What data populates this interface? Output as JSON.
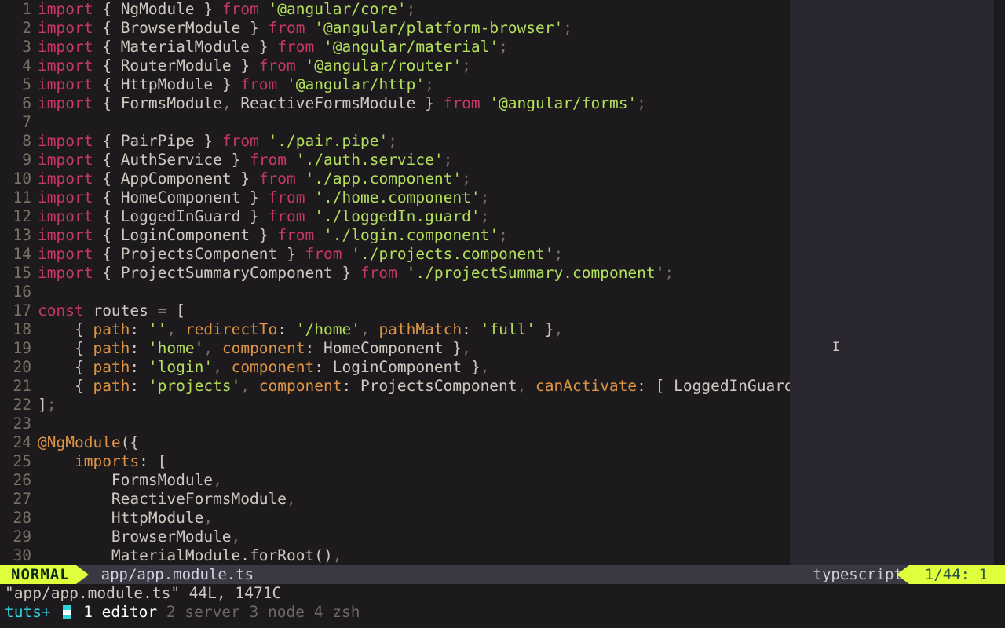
{
  "lines": [
    {
      "n": "1",
      "tokens": [
        {
          "c": "keyword",
          "t": "import"
        },
        {
          "c": "punct",
          "t": " { "
        },
        {
          "c": "ident",
          "t": "NgModule"
        },
        {
          "c": "punct",
          "t": " } "
        },
        {
          "c": "from",
          "t": "from"
        },
        {
          "c": "punct",
          "t": " "
        },
        {
          "c": "string",
          "t": "'@angular/core'"
        },
        {
          "c": "semi",
          "t": ";"
        }
      ]
    },
    {
      "n": "2",
      "tokens": [
        {
          "c": "keyword",
          "t": "import"
        },
        {
          "c": "punct",
          "t": " { "
        },
        {
          "c": "ident",
          "t": "BrowserModule"
        },
        {
          "c": "punct",
          "t": " } "
        },
        {
          "c": "from",
          "t": "from"
        },
        {
          "c": "punct",
          "t": " "
        },
        {
          "c": "string",
          "t": "'@angular/platform-browser'"
        },
        {
          "c": "semi",
          "t": ";"
        }
      ]
    },
    {
      "n": "3",
      "tokens": [
        {
          "c": "keyword",
          "t": "import"
        },
        {
          "c": "punct",
          "t": " { "
        },
        {
          "c": "ident",
          "t": "MaterialModule"
        },
        {
          "c": "punct",
          "t": " } "
        },
        {
          "c": "from",
          "t": "from"
        },
        {
          "c": "punct",
          "t": " "
        },
        {
          "c": "string",
          "t": "'@angular/material'"
        },
        {
          "c": "semi",
          "t": ";"
        }
      ]
    },
    {
      "n": "4",
      "tokens": [
        {
          "c": "keyword",
          "t": "import"
        },
        {
          "c": "punct",
          "t": " { "
        },
        {
          "c": "ident",
          "t": "RouterModule"
        },
        {
          "c": "punct",
          "t": " } "
        },
        {
          "c": "from",
          "t": "from"
        },
        {
          "c": "punct",
          "t": " "
        },
        {
          "c": "string",
          "t": "'@angular/router'"
        },
        {
          "c": "semi",
          "t": ";"
        }
      ]
    },
    {
      "n": "5",
      "tokens": [
        {
          "c": "keyword",
          "t": "import"
        },
        {
          "c": "punct",
          "t": " { "
        },
        {
          "c": "ident",
          "t": "HttpModule"
        },
        {
          "c": "punct",
          "t": " } "
        },
        {
          "c": "from",
          "t": "from"
        },
        {
          "c": "punct",
          "t": " "
        },
        {
          "c": "string",
          "t": "'@angular/http'"
        },
        {
          "c": "semi",
          "t": ";"
        }
      ]
    },
    {
      "n": "6",
      "tokens": [
        {
          "c": "keyword",
          "t": "import"
        },
        {
          "c": "punct",
          "t": " { "
        },
        {
          "c": "ident",
          "t": "FormsModule"
        },
        {
          "c": "comma",
          "t": ", "
        },
        {
          "c": "ident",
          "t": "ReactiveFormsModule"
        },
        {
          "c": "punct",
          "t": " } "
        },
        {
          "c": "from",
          "t": "from"
        },
        {
          "c": "punct",
          "t": " "
        },
        {
          "c": "string",
          "t": "'@angular/forms'"
        },
        {
          "c": "semi",
          "t": ";"
        }
      ]
    },
    {
      "n": "7",
      "tokens": []
    },
    {
      "n": "8",
      "tokens": [
        {
          "c": "keyword",
          "t": "import"
        },
        {
          "c": "punct",
          "t": " { "
        },
        {
          "c": "ident",
          "t": "PairPipe"
        },
        {
          "c": "punct",
          "t": " } "
        },
        {
          "c": "from",
          "t": "from"
        },
        {
          "c": "punct",
          "t": " "
        },
        {
          "c": "string",
          "t": "'./pair.pipe'"
        },
        {
          "c": "semi",
          "t": ";"
        }
      ]
    },
    {
      "n": "9",
      "tokens": [
        {
          "c": "keyword",
          "t": "import"
        },
        {
          "c": "punct",
          "t": " { "
        },
        {
          "c": "ident",
          "t": "AuthService"
        },
        {
          "c": "punct",
          "t": " } "
        },
        {
          "c": "from",
          "t": "from"
        },
        {
          "c": "punct",
          "t": " "
        },
        {
          "c": "string",
          "t": "'./auth.service'"
        },
        {
          "c": "semi",
          "t": ";"
        }
      ]
    },
    {
      "n": "10",
      "tokens": [
        {
          "c": "keyword",
          "t": "import"
        },
        {
          "c": "punct",
          "t": " { "
        },
        {
          "c": "ident",
          "t": "AppComponent"
        },
        {
          "c": "punct",
          "t": " } "
        },
        {
          "c": "from",
          "t": "from"
        },
        {
          "c": "punct",
          "t": " "
        },
        {
          "c": "string",
          "t": "'./app.component'"
        },
        {
          "c": "semi",
          "t": ";"
        }
      ]
    },
    {
      "n": "11",
      "tokens": [
        {
          "c": "keyword",
          "t": "import"
        },
        {
          "c": "punct",
          "t": " { "
        },
        {
          "c": "ident",
          "t": "HomeComponent"
        },
        {
          "c": "punct",
          "t": " } "
        },
        {
          "c": "from",
          "t": "from"
        },
        {
          "c": "punct",
          "t": " "
        },
        {
          "c": "string",
          "t": "'./home.component'"
        },
        {
          "c": "semi",
          "t": ";"
        }
      ]
    },
    {
      "n": "12",
      "tokens": [
        {
          "c": "keyword",
          "t": "import"
        },
        {
          "c": "punct",
          "t": " { "
        },
        {
          "c": "ident",
          "t": "LoggedInGuard"
        },
        {
          "c": "punct",
          "t": " } "
        },
        {
          "c": "from",
          "t": "from"
        },
        {
          "c": "punct",
          "t": " "
        },
        {
          "c": "string",
          "t": "'./loggedIn.guard'"
        },
        {
          "c": "semi",
          "t": ";"
        }
      ]
    },
    {
      "n": "13",
      "tokens": [
        {
          "c": "keyword",
          "t": "import"
        },
        {
          "c": "punct",
          "t": " { "
        },
        {
          "c": "ident",
          "t": "LoginComponent"
        },
        {
          "c": "punct",
          "t": " } "
        },
        {
          "c": "from",
          "t": "from"
        },
        {
          "c": "punct",
          "t": " "
        },
        {
          "c": "string",
          "t": "'./login.component'"
        },
        {
          "c": "semi",
          "t": ";"
        }
      ]
    },
    {
      "n": "14",
      "tokens": [
        {
          "c": "keyword",
          "t": "import"
        },
        {
          "c": "punct",
          "t": " { "
        },
        {
          "c": "ident",
          "t": "ProjectsComponent"
        },
        {
          "c": "punct",
          "t": " } "
        },
        {
          "c": "from",
          "t": "from"
        },
        {
          "c": "punct",
          "t": " "
        },
        {
          "c": "string",
          "t": "'./projects.component'"
        },
        {
          "c": "semi",
          "t": ";"
        }
      ]
    },
    {
      "n": "15",
      "tokens": [
        {
          "c": "keyword",
          "t": "import"
        },
        {
          "c": "punct",
          "t": " { "
        },
        {
          "c": "ident",
          "t": "ProjectSummaryComponent"
        },
        {
          "c": "punct",
          "t": " } "
        },
        {
          "c": "from",
          "t": "from"
        },
        {
          "c": "punct",
          "t": " "
        },
        {
          "c": "string",
          "t": "'./projectSummary.component'"
        },
        {
          "c": "semi",
          "t": ";"
        }
      ]
    },
    {
      "n": "16",
      "tokens": []
    },
    {
      "n": "17",
      "tokens": [
        {
          "c": "keyword",
          "t": "const"
        },
        {
          "c": "punct",
          "t": " "
        },
        {
          "c": "ident",
          "t": "routes = ["
        }
      ]
    },
    {
      "n": "18",
      "tokens": [
        {
          "c": "punct",
          "t": "    { "
        },
        {
          "c": "prop",
          "t": "path"
        },
        {
          "c": "punct",
          "t": ": "
        },
        {
          "c": "string",
          "t": "''"
        },
        {
          "c": "comma",
          "t": ", "
        },
        {
          "c": "prop",
          "t": "redirectTo"
        },
        {
          "c": "punct",
          "t": ": "
        },
        {
          "c": "string",
          "t": "'/home'"
        },
        {
          "c": "comma",
          "t": ", "
        },
        {
          "c": "prop",
          "t": "pathMatch"
        },
        {
          "c": "punct",
          "t": ": "
        },
        {
          "c": "string",
          "t": "'full'"
        },
        {
          "c": "punct",
          "t": " }"
        },
        {
          "c": "comma",
          "t": ","
        }
      ]
    },
    {
      "n": "19",
      "tokens": [
        {
          "c": "punct",
          "t": "    { "
        },
        {
          "c": "prop",
          "t": "path"
        },
        {
          "c": "punct",
          "t": ": "
        },
        {
          "c": "string",
          "t": "'home'"
        },
        {
          "c": "comma",
          "t": ", "
        },
        {
          "c": "prop",
          "t": "component"
        },
        {
          "c": "punct",
          "t": ": HomeComponent }"
        },
        {
          "c": "comma",
          "t": ","
        }
      ]
    },
    {
      "n": "20",
      "tokens": [
        {
          "c": "punct",
          "t": "    { "
        },
        {
          "c": "prop",
          "t": "path"
        },
        {
          "c": "punct",
          "t": ": "
        },
        {
          "c": "string",
          "t": "'login'"
        },
        {
          "c": "comma",
          "t": ", "
        },
        {
          "c": "prop",
          "t": "component"
        },
        {
          "c": "punct",
          "t": ": LoginComponent }"
        },
        {
          "c": "comma",
          "t": ","
        }
      ]
    },
    {
      "n": "21",
      "tokens": [
        {
          "c": "punct",
          "t": "    { "
        },
        {
          "c": "prop",
          "t": "path"
        },
        {
          "c": "punct",
          "t": ": "
        },
        {
          "c": "string",
          "t": "'projects'"
        },
        {
          "c": "comma",
          "t": ", "
        },
        {
          "c": "prop",
          "t": "component"
        },
        {
          "c": "punct",
          "t": ": ProjectsComponent"
        },
        {
          "c": "comma",
          "t": ", "
        },
        {
          "c": "prop",
          "t": "canActivate"
        },
        {
          "c": "punct",
          "t": ": [ LoggedInGuard ] }"
        }
      ]
    },
    {
      "n": "22",
      "tokens": [
        {
          "c": "punct",
          "t": "]"
        },
        {
          "c": "semi",
          "t": ";"
        }
      ]
    },
    {
      "n": "23",
      "tokens": []
    },
    {
      "n": "24",
      "tokens": [
        {
          "c": "decorator",
          "t": "@NgModule"
        },
        {
          "c": "punct",
          "t": "({"
        }
      ]
    },
    {
      "n": "25",
      "tokens": [
        {
          "c": "punct",
          "t": "    "
        },
        {
          "c": "prop",
          "t": "imports"
        },
        {
          "c": "punct",
          "t": ": ["
        }
      ]
    },
    {
      "n": "26",
      "tokens": [
        {
          "c": "punct",
          "t": "        FormsModule"
        },
        {
          "c": "comma",
          "t": ","
        }
      ]
    },
    {
      "n": "27",
      "tokens": [
        {
          "c": "punct",
          "t": "        ReactiveFormsModule"
        },
        {
          "c": "comma",
          "t": ","
        }
      ]
    },
    {
      "n": "28",
      "tokens": [
        {
          "c": "punct",
          "t": "        HttpModule"
        },
        {
          "c": "comma",
          "t": ","
        }
      ]
    },
    {
      "n": "29",
      "tokens": [
        {
          "c": "punct",
          "t": "        BrowserModule"
        },
        {
          "c": "comma",
          "t": ","
        }
      ]
    },
    {
      "n": "30",
      "tokens": [
        {
          "c": "punct",
          "t": "        MaterialModule.forRoot()"
        },
        {
          "c": "comma",
          "t": ","
        }
      ]
    }
  ],
  "status": {
    "mode": " NORMAL ",
    "file": "app/app.module.ts",
    "filetype": "typescript",
    "position": "1/44:   1 "
  },
  "message": "\"app/app.module.ts\" 44L, 1471C",
  "tmux": {
    "session": "tuts+",
    "windows": [
      {
        "idx": "1",
        "name": "editor",
        "active": true
      },
      {
        "idx": "2",
        "name": "server",
        "active": false
      },
      {
        "idx": "3",
        "name": "node",
        "active": false
      },
      {
        "idx": "4",
        "name": "zsh",
        "active": false
      }
    ]
  }
}
